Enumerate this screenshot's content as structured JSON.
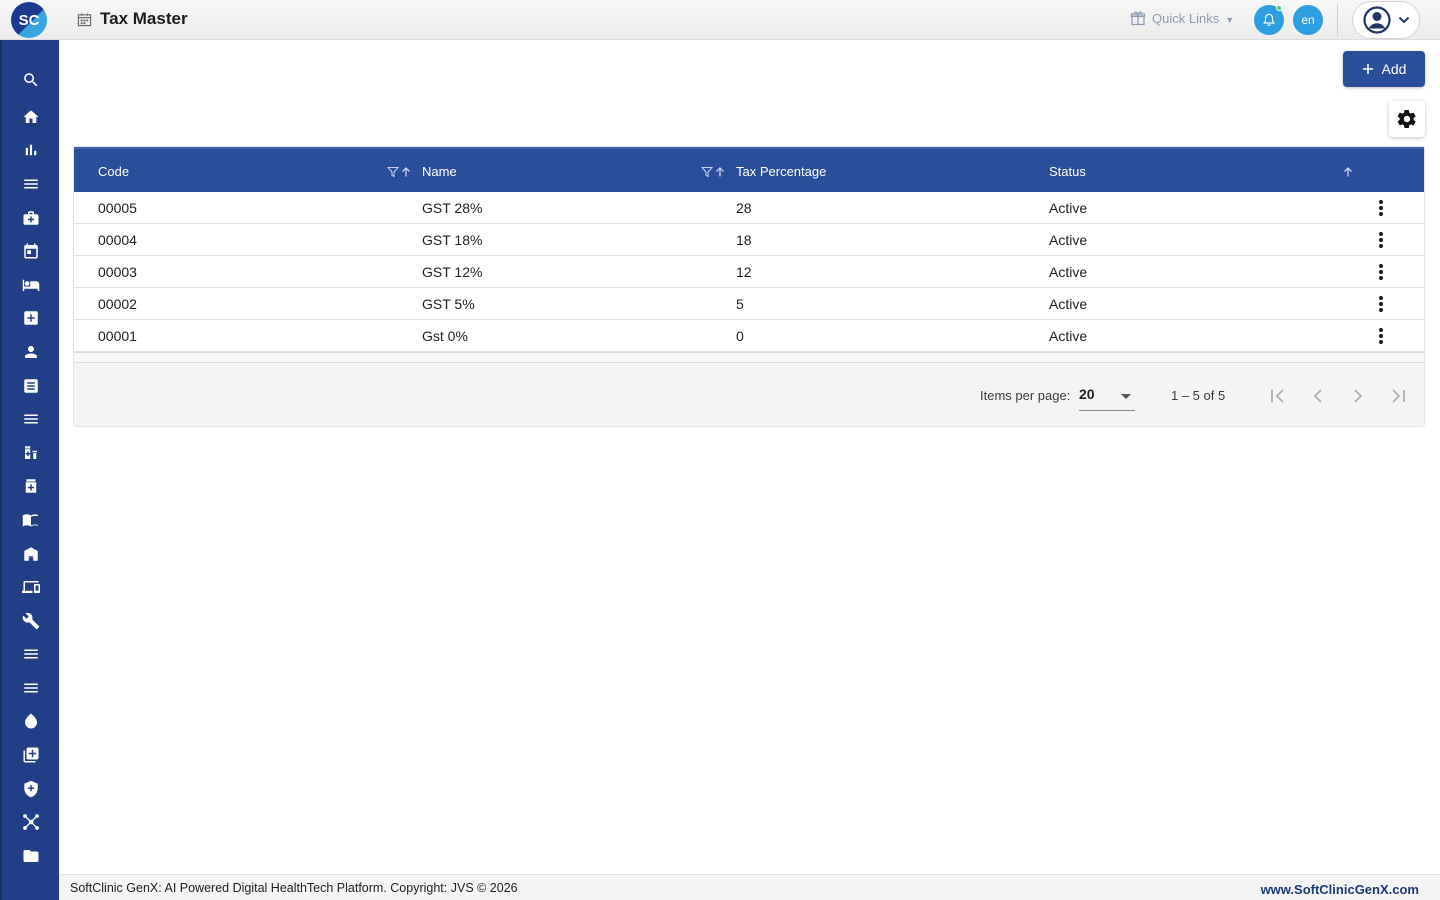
{
  "app": {
    "logo_text": "SC",
    "page_title": "Tax Master",
    "quick_links_label": "Quick Links",
    "language": "en",
    "colors": {
      "primary": "#2a4f9a",
      "sidebar": "#213f87",
      "accent": "#2d9fe0",
      "online_dot": "#3fd56a"
    }
  },
  "sidebar": {
    "items": [
      {
        "icon": "search-icon"
      },
      {
        "icon": "home-icon"
      },
      {
        "icon": "bar-chart-icon"
      },
      {
        "icon": "menu-lines-icon"
      },
      {
        "icon": "medical-bag-icon"
      },
      {
        "icon": "calendar-icon"
      },
      {
        "icon": "bed-icon"
      },
      {
        "icon": "plus-box-icon"
      },
      {
        "icon": "person-icon"
      },
      {
        "icon": "document-icon"
      },
      {
        "icon": "menu-lines-icon"
      },
      {
        "icon": "medicine-bottle-icon"
      },
      {
        "icon": "pill-box-icon"
      },
      {
        "icon": "book-icon"
      },
      {
        "icon": "store-icon"
      },
      {
        "icon": "devices-icon"
      },
      {
        "icon": "wrench-icon"
      },
      {
        "icon": "menu-lines-icon"
      },
      {
        "icon": "menu-lines-icon"
      },
      {
        "icon": "drop-icon"
      },
      {
        "icon": "add-library-icon"
      },
      {
        "icon": "shield-plus-icon"
      },
      {
        "icon": "network-icon"
      },
      {
        "icon": "folder-icon"
      }
    ]
  },
  "toolbar": {
    "add_label": "Add",
    "add_icon": "plus-icon",
    "settings_icon": "gear-icon"
  },
  "table": {
    "columns": [
      "Code",
      "Name",
      "Tax Percentage",
      "Status"
    ],
    "rows": [
      {
        "code": "00005",
        "name": "GST 28%",
        "tax": "28",
        "status": "Active"
      },
      {
        "code": "00004",
        "name": "GST 18%",
        "tax": "18",
        "status": "Active"
      },
      {
        "code": "00003",
        "name": "GST 12%",
        "tax": "12",
        "status": "Active"
      },
      {
        "code": "00002",
        "name": "GST 5%",
        "tax": "5",
        "status": "Active"
      },
      {
        "code": "00001",
        "name": "Gst 0%",
        "tax": "0",
        "status": "Active"
      }
    ]
  },
  "paginator": {
    "items_per_page_label": "Items per page:",
    "items_per_page_value": "20",
    "range_label": "1 – 5 of 5"
  },
  "footer": {
    "left_text": "SoftClinic GenX: AI Powered Digital HealthTech Platform. Copyright: JVS © 2026",
    "right_text": "www.SoftClinicGenX.com"
  }
}
